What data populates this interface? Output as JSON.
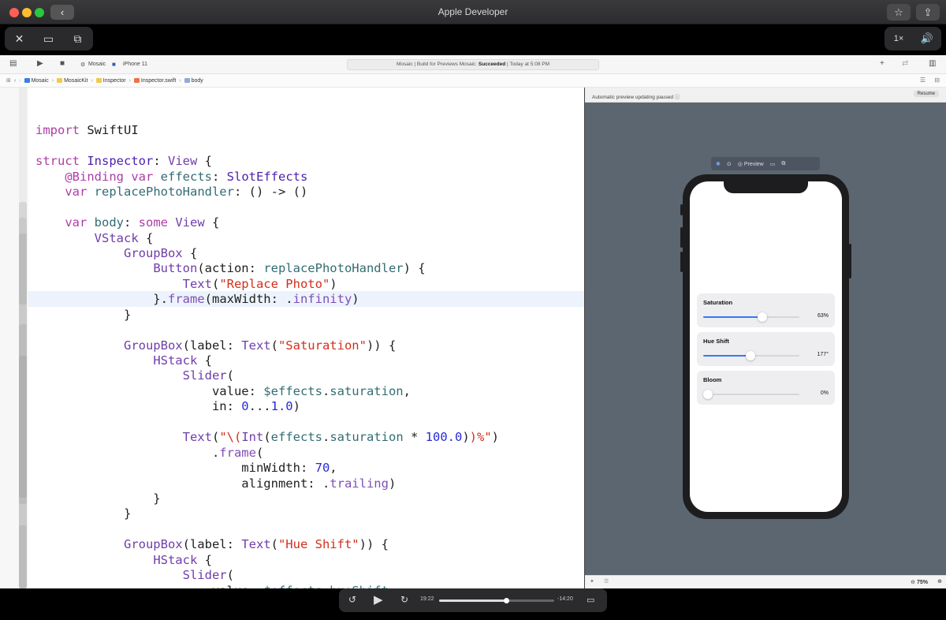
{
  "window": {
    "title": "Apple Developer"
  },
  "player_controls": {
    "speed": "1×"
  },
  "xcode": {
    "scheme": "Mosaic",
    "device": "iPhone 11",
    "status_prefix": "Mosaic | Build for Previews Mosaic: ",
    "status_result": "Succeeded",
    "status_suffix": " | Today at 5:08 PM",
    "breadcrumbs": [
      "Mosaic",
      "MosaicKit",
      "Inspector",
      "Inspector.swift",
      "body"
    ]
  },
  "preview": {
    "message": "Automatic preview updating paused",
    "resume_label": "Resume",
    "toolbar_preview_label": "Preview",
    "zoom": "75%",
    "groups": [
      {
        "label": "Saturation",
        "value_text": "63%",
        "fraction": 0.63
      },
      {
        "label": "Hue Shift",
        "value_text": "177°",
        "fraction": 0.49
      },
      {
        "label": "Bloom",
        "value_text": "0%",
        "fraction": 0.0
      }
    ]
  },
  "video": {
    "elapsed": "19:22",
    "remaining": "-14:20",
    "progress": 0.58
  },
  "colors": {
    "accent": "#3478f6",
    "preview_bg": "#5b6671"
  }
}
